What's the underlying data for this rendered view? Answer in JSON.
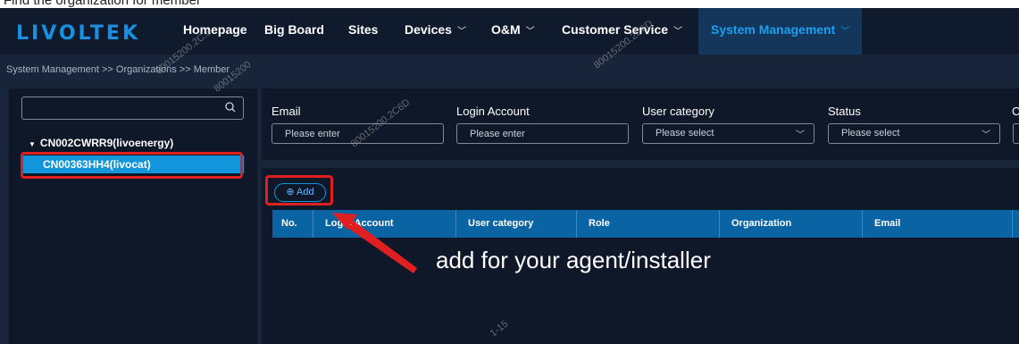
{
  "caption_text": "Find the organization for member",
  "app": {
    "logo_text": "LIVOLTEK",
    "brand_color": "#1a8fe0"
  },
  "nav": {
    "items": [
      {
        "label": "Homepage"
      },
      {
        "label": "Big Board"
      },
      {
        "label": "Sites"
      },
      {
        "label": "Devices",
        "dropdown": true
      },
      {
        "label": "O&M",
        "dropdown": true
      },
      {
        "label": "Customer Service",
        "dropdown": true
      },
      {
        "label": "System Management",
        "dropdown": true,
        "active": true
      }
    ],
    "chevron_icon": "chevron-down-icon"
  },
  "breadcrumb": "System Management >> Organizations >> Member",
  "tree": {
    "search_placeholder": "",
    "search_icon": "search-icon",
    "root_label": "CN002CWRR9(livoenergy)",
    "child_label": "CN00363HH4(livocat)"
  },
  "filters": [
    {
      "label": "Email",
      "placeholder": "Please enter",
      "kind": "input"
    },
    {
      "label": "Login Account",
      "placeholder": "Please enter",
      "kind": "input"
    },
    {
      "label": "User category",
      "placeholder": "Please select",
      "kind": "select"
    },
    {
      "label": "Status",
      "placeholder": "Please select",
      "kind": "select"
    },
    {
      "label": "C",
      "placeholder": "",
      "kind": "select"
    }
  ],
  "table": {
    "add_button_label": "⊕ Add",
    "columns": [
      "No.",
      "Login Account",
      "User category",
      "Role",
      "Organization",
      "Email"
    ],
    "rows": []
  },
  "annotation": {
    "text": "add for your agent/installer",
    "highlight_color": "#e02020"
  },
  "watermarks": [
    "80015200.2C.6",
    "80015200.2C6D",
    "80015200.2C6D",
    "80015200",
    "1-15"
  ]
}
